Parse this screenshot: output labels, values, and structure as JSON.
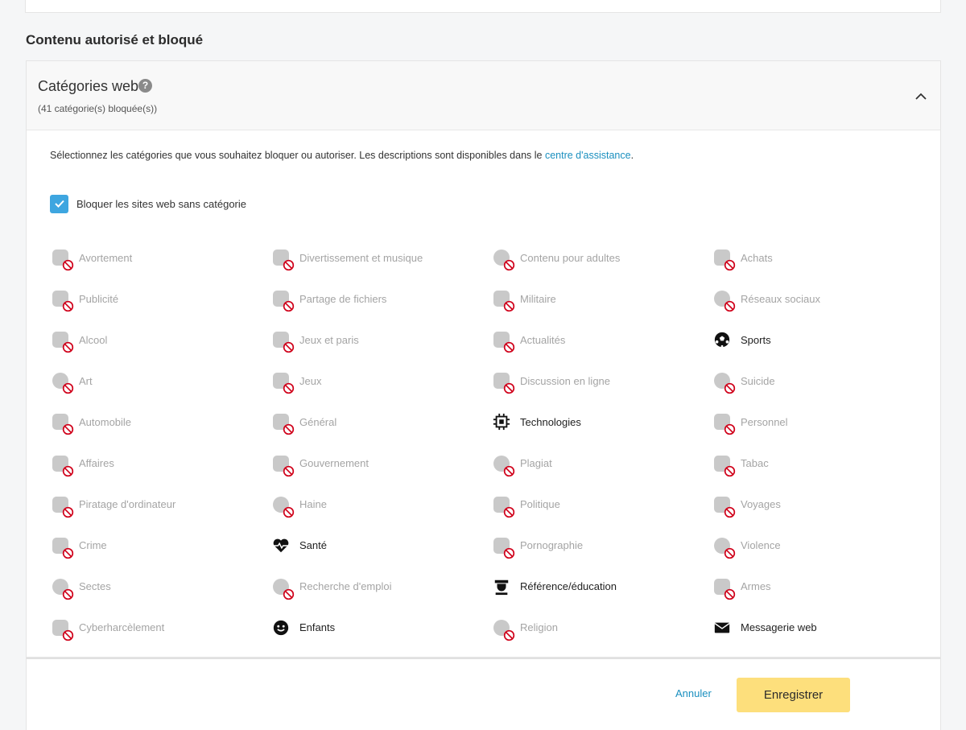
{
  "section_title": "Contenu autorisé et bloqué",
  "panel": {
    "title": "Catégories web",
    "help": "?",
    "subtitle": "(41 catégorie(s) bloquée(s))"
  },
  "description": {
    "text": "Sélectionnez les catégories que vous souhaitez bloquer ou autoriser. Les descriptions sont disponibles dans le ",
    "link": "centre d'assistance",
    "end": "."
  },
  "uncategorized": {
    "label": "Bloquer les sites web sans catégorie",
    "checked": true
  },
  "categories": [
    {
      "label": "Avortement",
      "status": "blocked",
      "icon": "abortion-icon"
    },
    {
      "label": "Divertissement et musique",
      "status": "blocked",
      "icon": "entertainment-icon"
    },
    {
      "label": "Contenu pour adultes",
      "status": "blocked",
      "icon": "adult-content-icon"
    },
    {
      "label": "Achats",
      "status": "blocked",
      "icon": "shopping-cart-icon"
    },
    {
      "label": "Publicité",
      "status": "blocked",
      "icon": "advertising-icon"
    },
    {
      "label": "Partage de fichiers",
      "status": "blocked",
      "icon": "file-sharing-icon"
    },
    {
      "label": "Militaire",
      "status": "blocked",
      "icon": "military-icon"
    },
    {
      "label": "Réseaux sociaux",
      "status": "blocked",
      "icon": "social-network-icon"
    },
    {
      "label": "Alcool",
      "status": "blocked",
      "icon": "alcohol-icon"
    },
    {
      "label": "Jeux et paris",
      "status": "blocked",
      "icon": "gambling-icon"
    },
    {
      "label": "Actualités",
      "status": "blocked",
      "icon": "news-icon"
    },
    {
      "label": "Sports",
      "status": "allowed",
      "icon": "soccer-ball-icon"
    },
    {
      "label": "Art",
      "status": "blocked",
      "icon": "art-palette-icon"
    },
    {
      "label": "Jeux",
      "status": "blocked",
      "icon": "gamepad-icon"
    },
    {
      "label": "Discussion en ligne",
      "status": "blocked",
      "icon": "chat-icon"
    },
    {
      "label": "Suicide",
      "status": "blocked",
      "icon": "suicide-icon"
    },
    {
      "label": "Automobile",
      "status": "blocked",
      "icon": "car-icon"
    },
    {
      "label": "Général",
      "status": "blocked",
      "icon": "general-grid-icon"
    },
    {
      "label": "Technologies",
      "status": "allowed",
      "icon": "chip-icon"
    },
    {
      "label": "Personnel",
      "status": "blocked",
      "icon": "personal-icon"
    },
    {
      "label": "Affaires",
      "status": "blocked",
      "icon": "briefcase-icon"
    },
    {
      "label": "Gouvernement",
      "status": "blocked",
      "icon": "government-icon"
    },
    {
      "label": "Plagiat",
      "status": "blocked",
      "icon": "plagiarism-icon"
    },
    {
      "label": "Tabac",
      "status": "blocked",
      "icon": "tobacco-icon"
    },
    {
      "label": "Piratage d'ordinateur",
      "status": "blocked",
      "icon": "hacking-icon"
    },
    {
      "label": "Haine",
      "status": "blocked",
      "icon": "hate-icon"
    },
    {
      "label": "Politique",
      "status": "blocked",
      "icon": "politics-icon"
    },
    {
      "label": "Voyages",
      "status": "blocked",
      "icon": "airplane-icon"
    },
    {
      "label": "Crime",
      "status": "blocked",
      "icon": "crime-icon"
    },
    {
      "label": "Santé",
      "status": "allowed",
      "icon": "heart-pulse-icon"
    },
    {
      "label": "Pornographie",
      "status": "blocked",
      "icon": "pornography-icon"
    },
    {
      "label": "Violence",
      "status": "blocked",
      "icon": "violence-icon"
    },
    {
      "label": "Sectes",
      "status": "blocked",
      "icon": "cult-icon"
    },
    {
      "label": "Recherche d'emploi",
      "status": "blocked",
      "icon": "job-search-icon"
    },
    {
      "label": "Référence/éducation",
      "status": "allowed",
      "icon": "graduation-icon"
    },
    {
      "label": "Armes",
      "status": "blocked",
      "icon": "weapons-icon"
    },
    {
      "label": "Cyberharcèlement",
      "status": "blocked",
      "icon": "cyberbullying-icon"
    },
    {
      "label": "Enfants",
      "status": "allowed",
      "icon": "smiley-icon"
    },
    {
      "label": "Religion",
      "status": "blocked",
      "icon": "religion-icon"
    },
    {
      "label": "Messagerie web",
      "status": "allowed",
      "icon": "envelope-icon"
    }
  ],
  "footer": {
    "cancel_label": "Annuler",
    "save_label": "Enregistrer"
  },
  "colors": {
    "accent": "#1a8fbf",
    "checkbox": "#3ea6e0",
    "save_button": "#fddf7c",
    "blocked_text": "#a4a4a4",
    "ban_red": "#d0021b"
  }
}
